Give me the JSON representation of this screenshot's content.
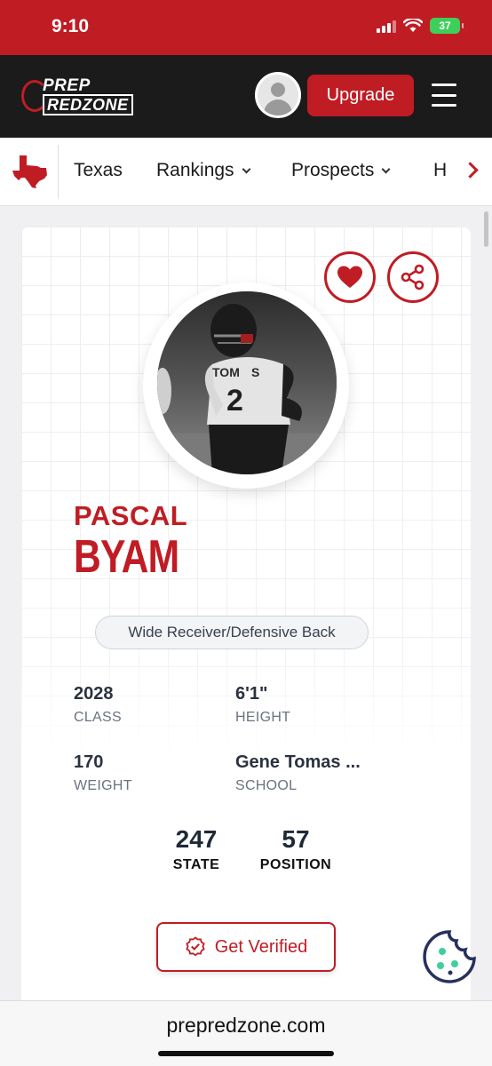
{
  "status_bar": {
    "time": "9:10",
    "battery": "37"
  },
  "header": {
    "logo_line1": "PREP",
    "logo_line2": "REDZONE",
    "upgrade_label": "Upgrade"
  },
  "nav": {
    "items": [
      {
        "label": "Texas"
      },
      {
        "label": "Rankings"
      },
      {
        "label": "Prospects"
      },
      {
        "label": "H"
      }
    ]
  },
  "profile": {
    "first_name": "PASCAL",
    "last_name": "BYAM",
    "position": "Wide Receiver/Defensive Back",
    "jersey_number": "2",
    "stats": [
      {
        "value": "2028",
        "label": "CLASS"
      },
      {
        "value": "6'1\"",
        "label": "HEIGHT"
      },
      {
        "value": "170",
        "label": "WEIGHT"
      },
      {
        "value": "Gene Tomas ...",
        "label": "SCHOOL"
      }
    ],
    "rankings": [
      {
        "value": "247",
        "label": "STATE"
      },
      {
        "value": "57",
        "label": "POSITION"
      }
    ],
    "verify_label": "Get Verified"
  },
  "browser": {
    "url": "prepredzone.com"
  },
  "colors": {
    "brand_red": "#c01c24",
    "header_dark": "#1b1b1b",
    "battery_green": "#3ecf5a"
  },
  "icons": [
    "signal-icon",
    "wifi-icon",
    "battery-icon",
    "texas-state-icon",
    "heart-icon",
    "share-icon",
    "verified-badge-icon",
    "cookie-icon",
    "hamburger-menu-icon"
  ]
}
